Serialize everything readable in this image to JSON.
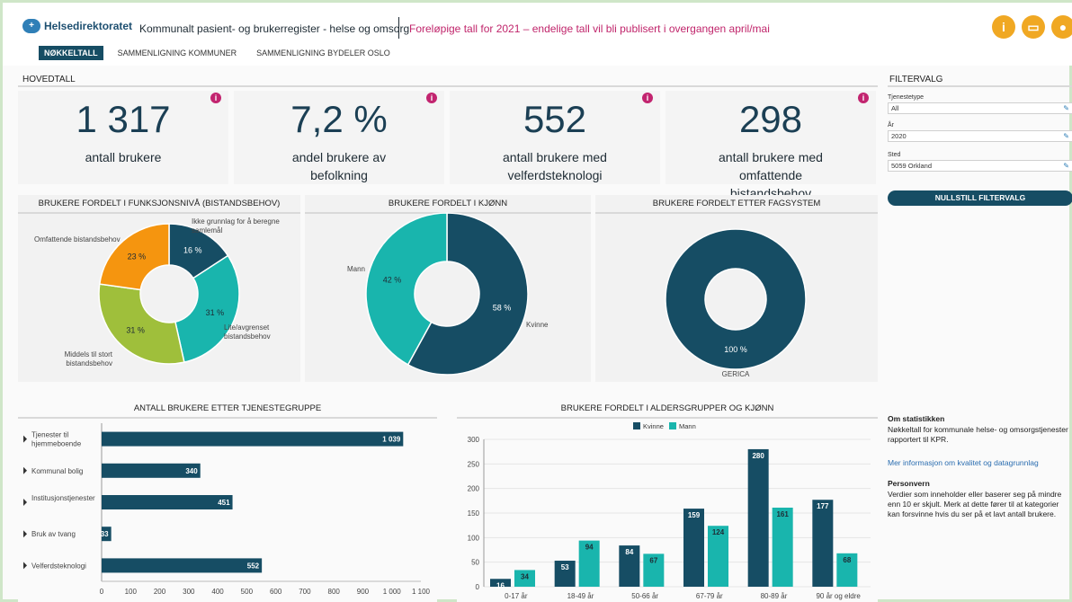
{
  "header": {
    "logo_text": "Helsedirektoratet",
    "app_title": "Kommunalt pasient- og brukerregister - helse og omsorg",
    "prelim_note": "Foreløpige tall for 2021 – endelige tall vil bli publisert i overgangen april/mai",
    "info_icon": "info-icon",
    "print_icon": "print-icon",
    "share_icon": "share-icon"
  },
  "tabs": [
    {
      "label": "NØKKELTALL",
      "active": true
    },
    {
      "label": "SAMMENLIGNING KOMMUNER",
      "active": false
    },
    {
      "label": "SAMMENLIGNING BYDELER OSLO",
      "active": false
    }
  ],
  "main": {
    "section_title": "HOVEDTALL",
    "kpis": [
      {
        "value": "1 317",
        "label": "antall brukere"
      },
      {
        "value": "7,2 %",
        "label": "andel brukere av befolkning"
      },
      {
        "value": "552",
        "label": "antall brukere med velferdsteknologi"
      },
      {
        "value": "298",
        "label": "antall brukere med omfattende bistandsbehov"
      }
    ],
    "info_glyph": "i"
  },
  "filters": {
    "title": "FILTERVALG",
    "fields": [
      {
        "label": "Tjenestetype",
        "value": "All"
      },
      {
        "label": "År",
        "value": "2020"
      },
      {
        "label": "Sted",
        "value": "5059 Orkland"
      }
    ],
    "reset_label": "NULLSTILL FILTERVALG"
  },
  "about": {
    "title": "Om statistikken",
    "text": "Nøkkeltall for kommunale helse- og omsorgstjenester rapportert til KPR.",
    "link": "Mer informasjon om kvalitet og datagrunnlag",
    "privacy_title": "Personvern",
    "privacy_text": "Verdier som inneholder eller baserer seg på mindre enn 10 er skjult. Merk at dette fører til at kategorier kan forsvinne hvis du ser på et lavt antall brukere."
  },
  "chart_data": [
    {
      "type": "pie",
      "title": "BRUKERE FORDELT I FUNKSJONSNIVÅ (BISTANDSBEHOV)",
      "labels": [
        "Ikke grunnlag for å beregne samlemål",
        "Lite/avgrenset bistandsbehov",
        "Middels til stort bistandsbehov",
        "Omfattende bistandsbehov"
      ],
      "values": [
        16,
        31,
        31,
        23
      ],
      "value_labels": [
        "16 %",
        "31 %",
        "31 %",
        "23 %"
      ],
      "colors": [
        "#164d64",
        "#19b5ad",
        "#9fbf3b",
        "#f5950f"
      ]
    },
    {
      "type": "pie",
      "title": "BRUKERE FORDELT I KJØNN",
      "labels": [
        "Kvinne",
        "Mann"
      ],
      "values": [
        58,
        42
      ],
      "value_labels": [
        "58 %",
        "42 %"
      ],
      "colors": [
        "#164d64",
        "#19b5ad"
      ]
    },
    {
      "type": "pie",
      "title": "BRUKERE FORDELT ETTER FAGSYSTEM",
      "labels": [
        "GERICA"
      ],
      "values": [
        100
      ],
      "value_labels": [
        "100 %"
      ],
      "colors": [
        "#164d64"
      ]
    },
    {
      "type": "bar",
      "orientation": "horizontal",
      "title": "ANTALL BRUKERE ETTER TJENESTEGRUPPE",
      "categories": [
        "Tjenester til hjemmeboende",
        "Kommunal bolig",
        "Institusjonstjenester",
        "Bruk av tvang",
        "Velferdsteknologi"
      ],
      "values": [
        1039,
        340,
        451,
        33,
        552
      ],
      "value_labels": [
        "1 039",
        "340",
        "451",
        "33",
        "552"
      ],
      "xlim": [
        0,
        1100
      ],
      "xticks": [
        "0",
        "100",
        "200",
        "300",
        "400",
        "500",
        "600",
        "700",
        "800",
        "900",
        "1 000",
        "1 100"
      ],
      "color": "#164d64"
    },
    {
      "type": "bar",
      "title": "BRUKERE FORDELT I ALDERSGRUPPER OG KJØNN",
      "categories": [
        "0-17 år",
        "18-49 år",
        "50-66 år",
        "67-79 år",
        "80-89 år",
        "90 år og eldre"
      ],
      "series": [
        {
          "name": "Kvinne",
          "values": [
            16,
            53,
            84,
            159,
            280,
            177
          ],
          "color": "#164d64"
        },
        {
          "name": "Mann",
          "values": [
            34,
            94,
            67,
            124,
            161,
            68
          ],
          "color": "#19b5ad"
        }
      ],
      "ylim": [
        0,
        300
      ],
      "yticks": [
        "0",
        "50",
        "100",
        "150",
        "200",
        "250",
        "300"
      ],
      "legend": "top"
    }
  ]
}
